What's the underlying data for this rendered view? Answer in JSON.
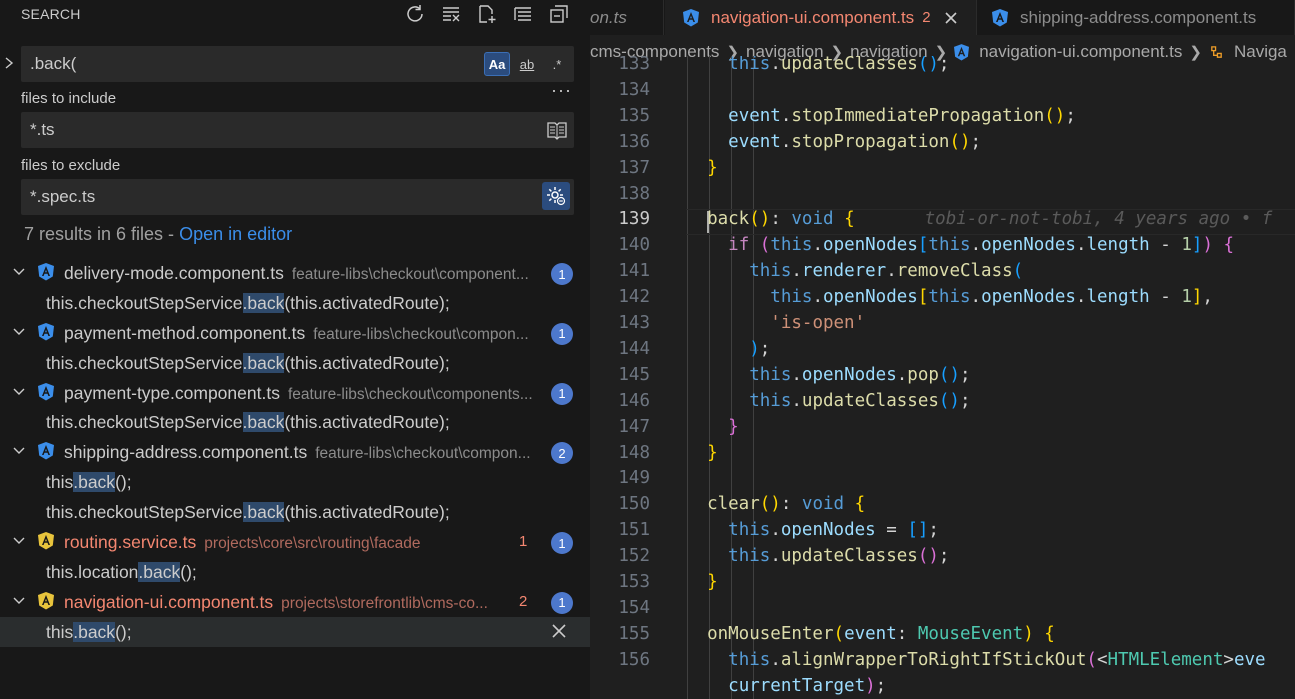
{
  "sidebar": {
    "title": "SEARCH",
    "actions": [
      {
        "name": "refresh-icon"
      },
      {
        "name": "clear-results-icon"
      },
      {
        "name": "new-search-editor-icon"
      },
      {
        "name": "collapse-all-icon"
      },
      {
        "name": "view-as-tree-icon"
      }
    ],
    "search": {
      "value": ".back(",
      "opt_case": "Aa",
      "opt_word": "ab",
      "opt_regex": ".*"
    },
    "include_label": "files to include",
    "include_value": "*.ts",
    "exclude_label": "files to exclude",
    "exclude_value": "*.spec.ts",
    "more": "···",
    "summary_text": "7 results in 6 files - ",
    "summary_link": "Open in editor",
    "results": [
      {
        "file": "delivery-mode.component.ts",
        "path": "feature-libs\\checkout\\component...",
        "count": "1",
        "error": false,
        "errcount": "",
        "matches": [
          {
            "pre": "this.checkoutStepService",
            "hit": ".back",
            "post": "(this.activatedRoute);"
          }
        ]
      },
      {
        "file": "payment-method.component.ts",
        "path": "feature-libs\\checkout\\compon...",
        "count": "1",
        "error": false,
        "errcount": "",
        "matches": [
          {
            "pre": "this.checkoutStepService",
            "hit": ".back",
            "post": "(this.activatedRoute);"
          }
        ]
      },
      {
        "file": "payment-type.component.ts",
        "path": "feature-libs\\checkout\\components...",
        "count": "1",
        "error": false,
        "errcount": "",
        "matches": [
          {
            "pre": "this.checkoutStepService",
            "hit": ".back",
            "post": "(this.activatedRoute);"
          }
        ]
      },
      {
        "file": "shipping-address.component.ts",
        "path": "feature-libs\\checkout\\compon...",
        "count": "2",
        "error": false,
        "errcount": "",
        "matches": [
          {
            "pre": "this",
            "hit": ".back",
            "post": "();"
          },
          {
            "pre": "this.checkoutStepService",
            "hit": ".back",
            "post": "(this.activatedRoute);"
          }
        ]
      },
      {
        "file": "routing.service.ts",
        "path": "projects\\core\\src\\routing\\facade",
        "count": "1",
        "error": true,
        "errcount": "1",
        "matches": [
          {
            "pre": "this.location",
            "hit": ".back",
            "post": "();"
          }
        ]
      },
      {
        "file": "navigation-ui.component.ts",
        "path": "projects\\storefrontlib\\cms-co...",
        "count": "1",
        "error": true,
        "errcount": "2",
        "matches": [
          {
            "pre": "this",
            "hit": ".back",
            "post": "();",
            "selected": true
          }
        ]
      }
    ]
  },
  "editor": {
    "tabs": [
      {
        "label": "on.ts"
      },
      {
        "label": "navigation-ui.component.ts",
        "errors": "2"
      },
      {
        "label": "shipping-address.component.ts"
      }
    ],
    "breadcrumb": [
      "cms-components",
      "navigation",
      "navigation",
      "navigation-ui.component.ts",
      "Naviga"
    ],
    "current_line": 139,
    "blame": "tobi-or-not-tobi, 4 years ago • f",
    "lines": [
      {
        "n": "133",
        "html": "    <span class='th'>this</span><span class='pu'>.</span><span class='fn'>updateClasses</span><span class='b3'>()</span><span class='pu'>;</span>"
      },
      {
        "n": "134",
        "html": ""
      },
      {
        "n": "135",
        "html": "    <span class='pr'>event</span><span class='pu'>.</span><span class='fn'>stopImmediatePropagation</span><span class='b1'>()</span><span class='pu'>;</span>"
      },
      {
        "n": "136",
        "html": "    <span class='pr'>event</span><span class='pu'>.</span><span class='fn'>stopPropagation</span><span class='b1'>()</span><span class='pu'>;</span>"
      },
      {
        "n": "137",
        "html": "  <span class='b1'>}</span>"
      },
      {
        "n": "138",
        "html": ""
      },
      {
        "n": "139",
        "html": "  <span class='fn'>back</span><span class='b1'>()</span><span class='pu'>: </span><span class='kw'>void</span> <span class='b1'>{</span>"
      },
      {
        "n": "140",
        "html": "    <span class='kw2'>if</span> <span class='b2'>(</span><span class='th'>this</span><span class='pu'>.</span><span class='pr'>openNodes</span><span class='b3'>[</span><span class='th'>this</span><span class='pu'>.</span><span class='pr'>openNodes</span><span class='pu'>.</span><span class='pr'>length</span> <span class='pu'>-</span> <span class='nm'>1</span><span class='b3'>]</span><span class='b2'>)</span> <span class='b2'>{</span>"
      },
      {
        "n": "141",
        "html": "      <span class='th'>this</span><span class='pu'>.</span><span class='pr'>renderer</span><span class='pu'>.</span><span class='fn'>removeClass</span><span class='b3'>(</span>"
      },
      {
        "n": "142",
        "html": "        <span class='th'>this</span><span class='pu'>.</span><span class='pr'>openNodes</span><span class='b1'>[</span><span class='th'>this</span><span class='pu'>.</span><span class='pr'>openNodes</span><span class='pu'>.</span><span class='pr'>length</span> <span class='pu'>-</span> <span class='nm'>1</span><span class='b1'>]</span><span class='pu'>,</span>"
      },
      {
        "n": "143",
        "html": "        <span class='st'>'is-open'</span>"
      },
      {
        "n": "144",
        "html": "      <span class='b3'>)</span><span class='pu'>;</span>"
      },
      {
        "n": "145",
        "html": "      <span class='th'>this</span><span class='pu'>.</span><span class='pr'>openNodes</span><span class='pu'>.</span><span class='fn'>pop</span><span class='b3'>()</span><span class='pu'>;</span>"
      },
      {
        "n": "146",
        "html": "      <span class='th'>this</span><span class='pu'>.</span><span class='fn'>updateClasses</span><span class='b3'>()</span><span class='pu'>;</span>"
      },
      {
        "n": "147",
        "html": "    <span class='b2'>}</span>"
      },
      {
        "n": "148",
        "html": "  <span class='b1'>}</span>"
      },
      {
        "n": "149",
        "html": ""
      },
      {
        "n": "150",
        "html": "  <span class='fn'>clear</span><span class='b1'>()</span><span class='pu'>: </span><span class='kw'>void</span> <span class='b1'>{</span>"
      },
      {
        "n": "151",
        "html": "    <span class='th'>this</span><span class='pu'>.</span><span class='pr'>openNodes</span> <span class='pu'>=</span> <span class='b3'>[]</span><span class='pu'>;</span>"
      },
      {
        "n": "152",
        "html": "    <span class='th'>this</span><span class='pu'>.</span><span class='fn'>updateClasses</span><span class='b2'>()</span><span class='pu'>;</span>"
      },
      {
        "n": "153",
        "html": "  <span class='b1'>}</span>"
      },
      {
        "n": "154",
        "html": ""
      },
      {
        "n": "155",
        "html": "  <span class='fn'>onMouseEnter</span><span class='b1'>(</span><span class='pr'>event</span><span class='pu'>: </span><span class='ty'>MouseEvent</span><span class='b1'>)</span> <span class='b1'>{</span>"
      },
      {
        "n": "156",
        "html": "    <span class='th'>this</span><span class='pu'>.</span><span class='fn'>alignWrapperToRightIfStickOut</span><span class='b2'>(</span><span class='pu'>&lt;</span><span class='ty'>HTMLElement</span><span class='pu'>&gt;</span><span class='pr'>eve</span>"
      },
      {
        "n": "",
        "html": "    <span class='pr'>currentTarget</span><span class='b2'>)</span><span class='pu'>;</span>"
      }
    ]
  },
  "colors": {
    "accent": "#4d78cc",
    "error": "#f48771",
    "angular_blue": "#3b8eea",
    "angular_yellow": "#e8c43c"
  }
}
